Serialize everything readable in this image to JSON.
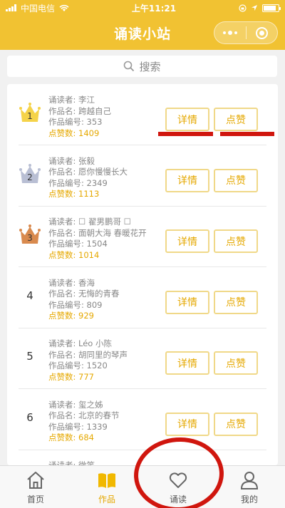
{
  "status": {
    "carrier": "中国电信",
    "time": "上午11:21",
    "battery_level": 0.85
  },
  "nav": {
    "title": "诵读小站"
  },
  "search": {
    "placeholder": "搜索"
  },
  "entries": [
    {
      "rank": "1",
      "crown": "gold",
      "reader": "诵读者: 李江",
      "work": "作品名: 跨越自己",
      "code": "作品编号: 353",
      "votes": "点赞数: 1409"
    },
    {
      "rank": "2",
      "crown": "silver",
      "reader": "诵读者: 张毅",
      "work": "作品名: 愿你慢慢长大",
      "code": "作品编号: 2349",
      "votes": "点赞数: 1113"
    },
    {
      "rank": "3",
      "crown": "bronze",
      "reader": "诵读者: ☐ 翟男鹏哥 ☐",
      "work": "作品名: 面朝大海 春暖花开",
      "code": "作品编号: 1504",
      "votes": "点赞数: 1014"
    },
    {
      "rank": "4",
      "crown": "",
      "reader": "诵读者: 香海",
      "work": "作品名: 无悔的青春",
      "code": "作品编号: 809",
      "votes": "点赞数: 929"
    },
    {
      "rank": "5",
      "crown": "",
      "reader": "诵读者: Léo 小陈",
      "work": "作品名: 胡同里的琴声",
      "code": "作品编号: 1520",
      "votes": "点赞数: 777"
    },
    {
      "rank": "6",
      "crown": "",
      "reader": "诵读者: 玺之姊",
      "work": "作品名: 北京的春节",
      "code": "作品编号: 1339",
      "votes": "点赞数: 684"
    },
    {
      "rank": "",
      "crown": "",
      "reader": "诵读者: 微笑",
      "work": "",
      "code": "",
      "votes": ""
    }
  ],
  "buttons": {
    "detail": "详情",
    "like": "点赞"
  },
  "tabs": [
    {
      "label": "首页",
      "icon": "home-icon"
    },
    {
      "label": "作品",
      "icon": "book-icon"
    },
    {
      "label": "诵读",
      "icon": "heart-icon"
    },
    {
      "label": "我的",
      "icon": "person-icon"
    }
  ],
  "colors": {
    "accent": "#f1c232",
    "button_text": "#e5a800",
    "annotation_red": "#d0160e"
  }
}
